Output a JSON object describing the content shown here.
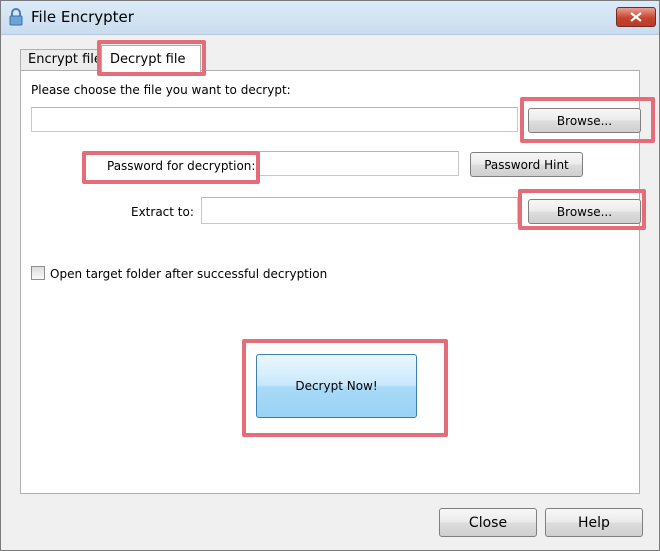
{
  "window": {
    "title": "File Encrypter"
  },
  "tabs": [
    {
      "label": "Encrypt file",
      "active": false
    },
    {
      "label": "Decrypt file",
      "active": true
    }
  ],
  "decrypt": {
    "choose_label": "Please choose the file you want to decrypt:",
    "file_path_value": "",
    "browse_label": "Browse...",
    "password_label": "Password for decryption:",
    "password_value": "",
    "password_hint_label": "Password Hint",
    "extract_label": "Extract to:",
    "extract_path_value": "",
    "extract_browse_label": "Browse...",
    "open_folder_label": "Open target folder after successful decryption",
    "open_folder_checked": false,
    "decrypt_now_label": "Decrypt Now!"
  },
  "footer": {
    "close_label": "Close",
    "help_label": "Help"
  },
  "colors": {
    "highlight": "#e56d7a",
    "accent": "#99d2f5"
  },
  "icons": {
    "app": "lock-icon",
    "close": "close-icon"
  }
}
